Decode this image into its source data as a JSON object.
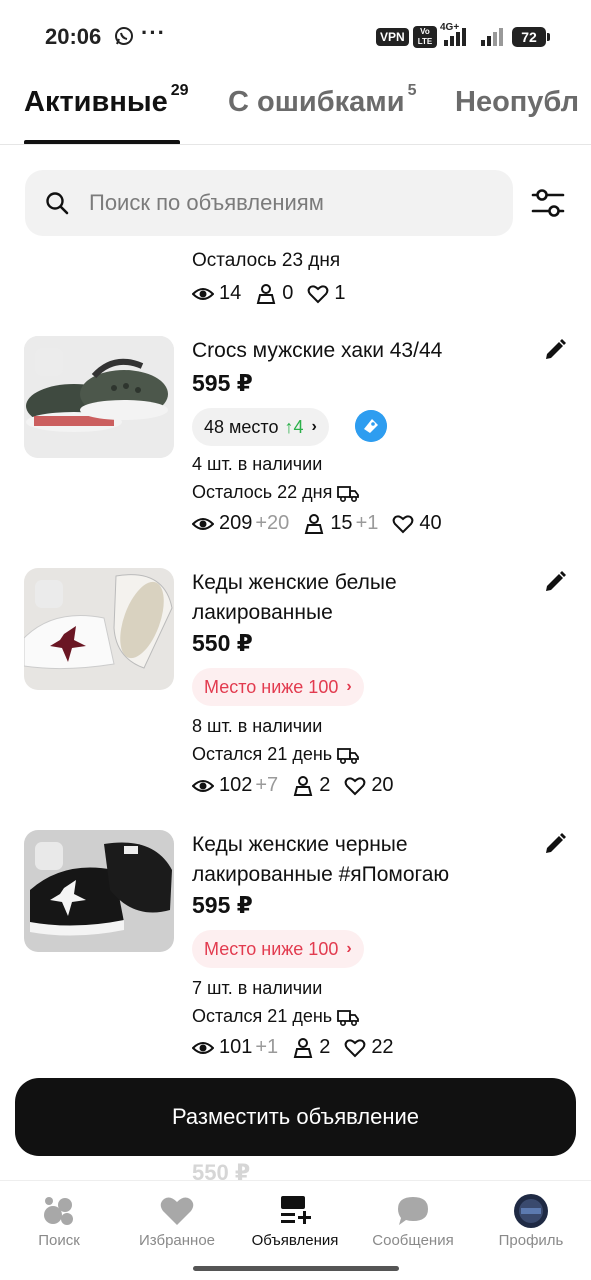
{
  "status_bar": {
    "time": "20:06",
    "dots": "···",
    "vpn": "VPN",
    "volte": "Vo LTE",
    "net": "4G+",
    "battery": "72"
  },
  "tabs": [
    {
      "label": "Активные",
      "count": "29",
      "active": true
    },
    {
      "label": "С ошибками",
      "count": "5",
      "active": false
    },
    {
      "label": "Неопубл",
      "count": "",
      "active": false
    }
  ],
  "search": {
    "placeholder": "Поиск по объявлениям"
  },
  "partial_item": {
    "remaining": "Осталось 23 дня",
    "views": "14",
    "contacts": "0",
    "likes": "1"
  },
  "listings": [
    {
      "title": "Crocs мужские хаки 43/44",
      "price": "595 ₽",
      "promo_label": "48 место",
      "promo_change": "↑4",
      "stock": "4 шт. в наличии",
      "remaining": "Осталось 22 дня",
      "views": "209",
      "views_delta": "+20",
      "contacts": "15",
      "contacts_delta": "+1",
      "likes": "40"
    },
    {
      "title": "Кеды женские белые лакированные",
      "price": "550 ₽",
      "promo_label": "Место ниже 100",
      "stock": "8 шт. в наличии",
      "remaining": "Остался 21 день",
      "views": "102",
      "views_delta": "+7",
      "contacts": "2",
      "likes": "20"
    },
    {
      "title": "Кеды женские черные лакированные #яПомогаю",
      "price": "595 ₽",
      "promo_label": "Место ниже 100",
      "stock": "7 шт. в наличии",
      "remaining": "Остался 21 день",
      "views": "101",
      "views_delta": "+1",
      "contacts": "2",
      "likes": "22"
    }
  ],
  "cta": {
    "label": "Разместить объявление"
  },
  "ghost_price": "550 ₽",
  "bottom_nav": [
    {
      "label": "Поиск",
      "icon": "search-circles-icon"
    },
    {
      "label": "Избранное",
      "icon": "heart-icon"
    },
    {
      "label": "Объявления",
      "icon": "listings-add-icon",
      "active": true
    },
    {
      "label": "Сообщения",
      "icon": "chat-bubble-icon"
    },
    {
      "label": "Профиль",
      "icon": "avatar"
    }
  ],
  "colors": {
    "accent_red": "#e23b4f",
    "up_green": "#2bb04a",
    "badge_blue": "#2e9df0",
    "cta_black": "#111111"
  }
}
